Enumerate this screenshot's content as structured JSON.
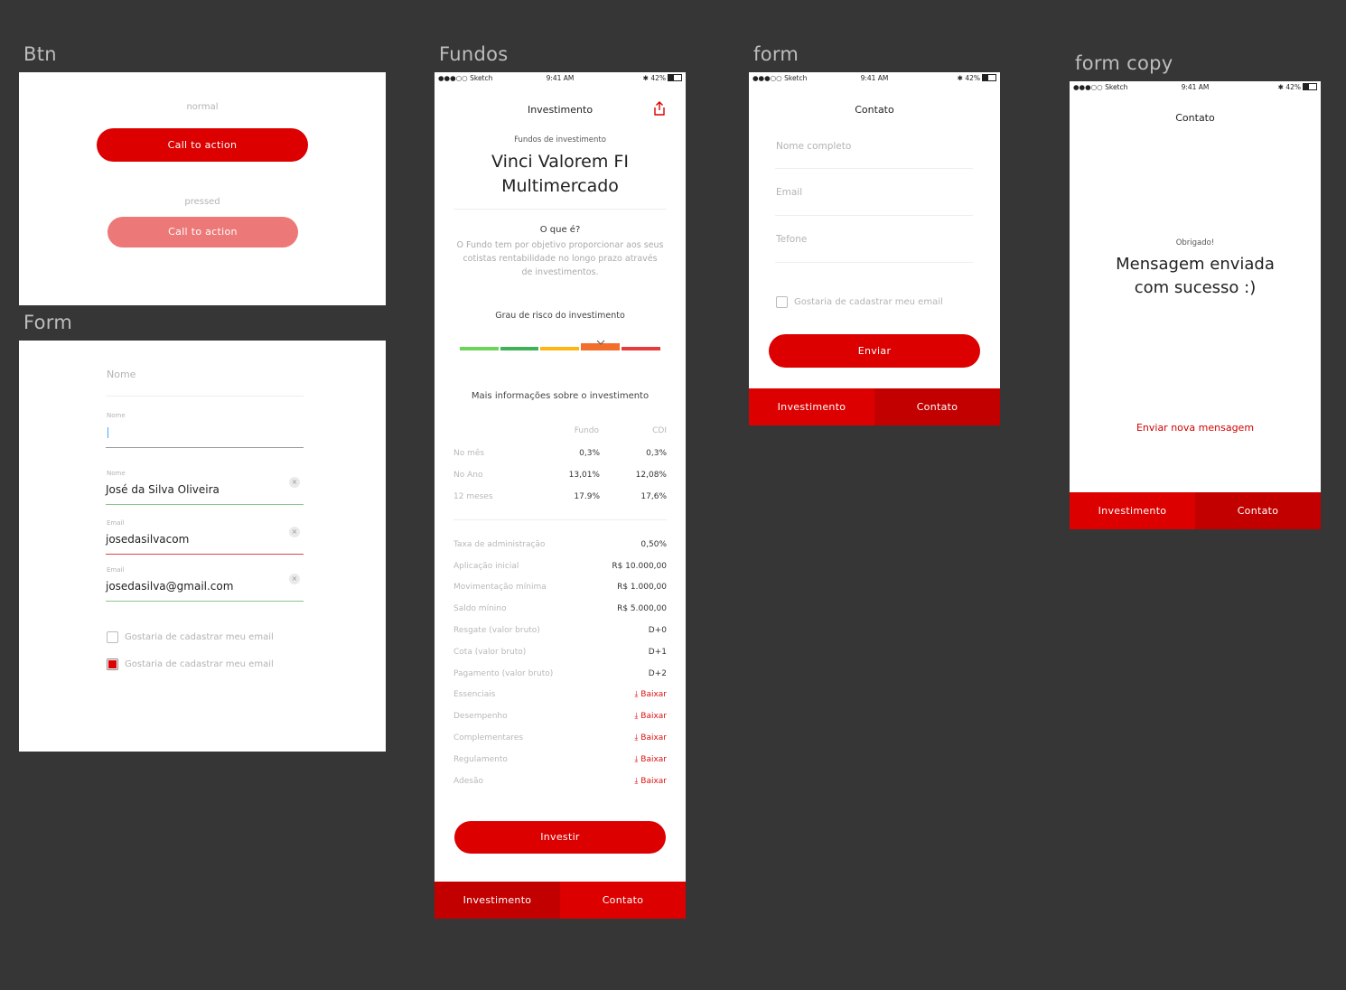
{
  "labels": {
    "btn": "Btn",
    "form": "Form",
    "fundos": "Fundos",
    "form2": "form",
    "form_copy": "form copy"
  },
  "colors": {
    "primary": "#dc0000",
    "primary_pressed": "#ec7878",
    "tab_active": "#c20000",
    "risk": [
      "#6fd35a",
      "#3fb157",
      "#ffb516",
      "#f36e2b",
      "#e63b3b"
    ]
  },
  "btn_board": {
    "normal_label": "normal",
    "pressed_label": "pressed",
    "cta": "Call to action",
    "cta_pressed": "Call to action"
  },
  "form_board": {
    "field1_placeholder": "Nome",
    "field2_label": "Nome",
    "field3_label": "Nome",
    "field3_value": "José da Silva Oliveira",
    "field4_label": "Email",
    "field4_value": "josedasilvacom",
    "field5_label": "Email",
    "field5_value": "josedasilva@gmail.com",
    "clear_glyph": "×",
    "checkbox1": "Gostaria de cadastrar meu email",
    "checkbox2": "Gostaria de cadastrar meu email"
  },
  "status": {
    "carrier": "●●●○○ Sketch",
    "time": "9:41 AM",
    "battery": "✱ 42%"
  },
  "fundos": {
    "title": "Investimento",
    "subtitle": "Fundos de investimento",
    "fund_name_1": "Vinci Valorem FI",
    "fund_name_2": "Multimercado",
    "what_title": "O que é?",
    "what_text": "O Fundo tem por objetivo proporcionar aos seus cotistas rentabilidade no longo prazo através de investimentos.",
    "risk_title": "Grau de risco do investimento",
    "risk_level": 4,
    "more_title": "Mais informações sobre o investimento",
    "col_fundo": "Fundo",
    "col_cdi": "CDI",
    "perf": [
      {
        "label": "No mês",
        "fundo": "0,3%",
        "cdi": "0,3%"
      },
      {
        "label": "No Ano",
        "fundo": "13,01%",
        "cdi": "12,08%"
      },
      {
        "label": "12 meses",
        "fundo": "17.9%",
        "cdi": "17,6%"
      }
    ],
    "details": [
      {
        "label": "Taxa de administração",
        "value": "0,50%"
      },
      {
        "label": "Aplicação inicial",
        "value": "R$ 10.000,00"
      },
      {
        "label": "Movimentação mínima",
        "value": "R$ 1.000,00"
      },
      {
        "label": "Saldo mínino",
        "value": "R$ 5.000,00"
      },
      {
        "label": "Resgate (valor bruto)",
        "value": "D+0"
      },
      {
        "label": "Cota (valor bruto)",
        "value": "D+1"
      },
      {
        "label": "Pagamento (valor bruto)",
        "value": "D+2"
      }
    ],
    "downloads": [
      {
        "label": "Essenciais",
        "action": "Baixar"
      },
      {
        "label": "Desempenho",
        "action": "Baixar"
      },
      {
        "label": "Complementares",
        "action": "Baixar"
      },
      {
        "label": "Regulamento",
        "action": "Baixar"
      },
      {
        "label": "Adesão",
        "action": "Baixar"
      }
    ],
    "invest_button": "Investir"
  },
  "tabs": {
    "investimento": "Investimento",
    "contato": "Contato"
  },
  "contact": {
    "title": "Contato",
    "name_placeholder": "Nome completo",
    "email_placeholder": "Email",
    "phone_placeholder": "Tefone",
    "checkbox": "Gostaria de cadastrar meu email",
    "send_button": "Enviar"
  },
  "contact_success": {
    "title": "Contato",
    "thanks": "Obrigado!",
    "message_1": "Mensagem enviada",
    "message_2": "com sucesso :)",
    "new_message_link": "Enviar nova mensagem"
  }
}
